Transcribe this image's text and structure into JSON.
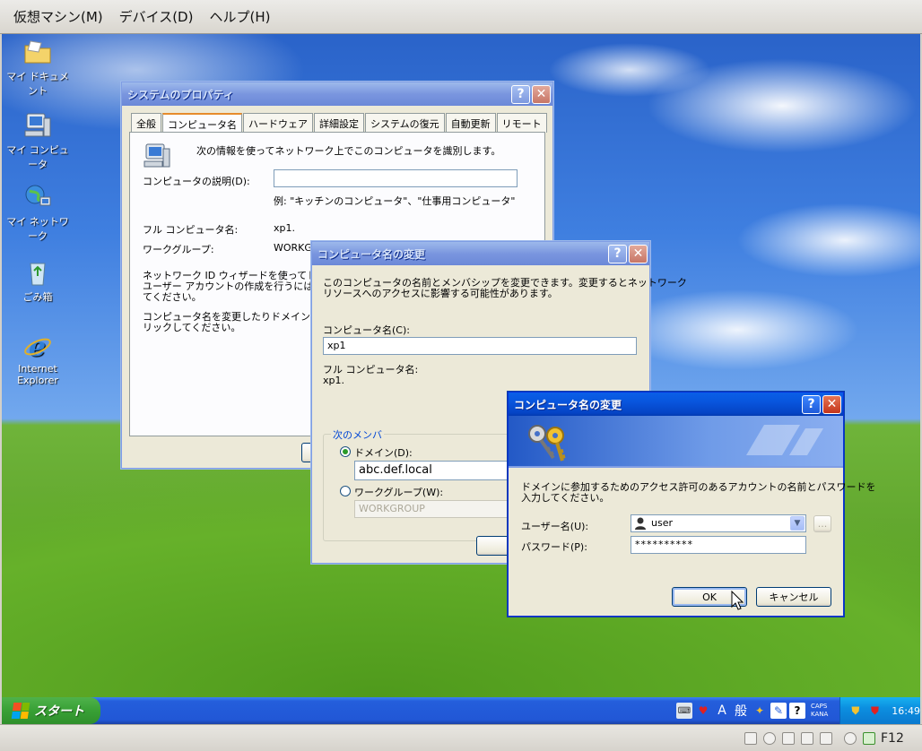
{
  "vm_menu": {
    "machine": "仮想マシン(M)",
    "devices": "デバイス(D)",
    "help": "ヘルプ(H)"
  },
  "desktop_icons": {
    "my_documents": "マイ ドキュメント",
    "my_computer": "マイ コンピュータ",
    "my_network": "マイ ネットワーク",
    "recycle_bin": "ごみ箱",
    "ie_line1": "Internet",
    "ie_line2": "Explorer"
  },
  "sysprops": {
    "title": "システムのプロパティ",
    "tabs": [
      "全般",
      "コンピュータ名",
      "ハードウェア",
      "詳細設定",
      "システムの復元",
      "自動更新",
      "リモート"
    ],
    "intro": "次の情報を使ってネットワーク上でこのコンピュータを識別します。",
    "desc_label": "コンピュータの説明(D):",
    "desc_example": "例: \"キッチンのコンピュータ\"、\"仕事用コンピュータ\"",
    "full_name_label": "フル コンピュータ名:",
    "full_name_value": "xp1.",
    "workgroup_label": "ワークグループ:",
    "workgroup_value": "WORKG",
    "netid_text_1": "ネットワーク ID ウィザードを使ってドメイン",
    "netid_text_2": "ユーザー アカウントの作成を行うには、[ネ",
    "netid_text_3": "てください。",
    "rename_text_1": "コンピュータ名を変更したりドメインに参加",
    "rename_text_2": "リックしてください。"
  },
  "rename": {
    "title": "コンピュータ名の変更",
    "desc_1": "このコンピュータの名前とメンバシップを変更できます。変更するとネットワーク",
    "desc_2": "リソースへのアクセスに影響する可能性があります。",
    "name_label": "コンピュータ名(C):",
    "name_value": "xp1",
    "full_label": "フル コンピュータ名:",
    "full_value": "xp1.",
    "member_group": "次のメンバ",
    "domain_label": "ドメイン(D):",
    "domain_value": "abc.def.local",
    "workgroup_label": "ワークグループ(W):",
    "workgroup_value": "WORKGROUP"
  },
  "creds": {
    "title": "コンピュータ名の変更",
    "desc_1": "ドメインに参加するためのアクセス許可のあるアカウントの名前とパスワードを",
    "desc_2": "入力してください。",
    "user_label": "ユーザー名(U):",
    "user_value": "user",
    "browse": "...",
    "password_label": "パスワード(P):",
    "password_value": "**********",
    "ok": "OK",
    "cancel": "キャンセル"
  },
  "taskbar": {
    "start": "スタート",
    "ime_mode": "A",
    "ime_kanji": "般",
    "caps": "CAPS",
    "kana": "KANA",
    "clock": "16:49"
  },
  "vm_status": {
    "host_key": "F12"
  },
  "colors": {
    "xp_blue": "#0855dd",
    "taskbar": "#245edb",
    "start_green": "#38a035",
    "tray": "#0c8fe0"
  }
}
